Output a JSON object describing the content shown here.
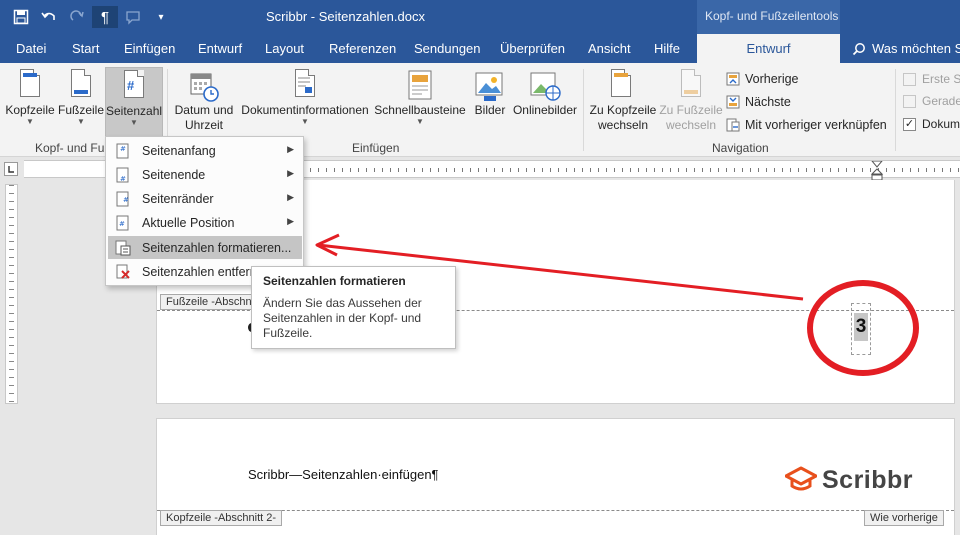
{
  "titlebar": {
    "document_title": "Scribbr - Seitenzahlen.docx",
    "contextual_title": "Kopf- und Fußzeilentools",
    "qat": {
      "save_icon": "save-icon",
      "undo_icon": "undo-icon",
      "redo_icon": "redo-icon",
      "pilcrow_label": "¶",
      "customize_icon": "chevron-down-icon"
    }
  },
  "tabs": [
    {
      "label": "Datei"
    },
    {
      "label": "Start"
    },
    {
      "label": "Einfügen"
    },
    {
      "label": "Entwurf"
    },
    {
      "label": "Layout"
    },
    {
      "label": "Referenzen"
    },
    {
      "label": "Sendungen"
    },
    {
      "label": "Überprüfen"
    },
    {
      "label": "Ansicht"
    },
    {
      "label": "Hilfe"
    },
    {
      "label": "Entwurf",
      "active": true
    }
  ],
  "tell_me": {
    "icon": "search-icon",
    "label": "Was möchten Si"
  },
  "ribbon": {
    "kopfzeile": "Kopfzeile",
    "fusszeile": "Fußzeile",
    "seitenzahl": "Seitenzahl",
    "datum_line1": "Datum und",
    "datum_line2": "Uhrzeit",
    "dokumentinformationen": "Dokumentinformationen",
    "schnellbausteine": "Schnellbausteine",
    "bilder": "Bilder",
    "onlinebilder": "Onlinebilder",
    "zu_kopfzeile_line1": "Zu Kopfzeile",
    "zu_kopfzeile_line2": "wechseln",
    "zu_fusszeile_line1": "Zu Fußzeile",
    "zu_fusszeile_line2": "wechseln",
    "vorherige": "Vorherige",
    "naechste": "Nächste",
    "verknuepfen": "Mit vorheriger verknüpfen",
    "erste_seite": "Erste Se",
    "gerade": "Gerade",
    "dokument": "Dokum",
    "group_kopf_fuss": "Kopf- und Fu",
    "group_einfuegen": "Einfügen",
    "group_navigation": "Navigation"
  },
  "menu": {
    "items": [
      {
        "label": "Seitenanfang",
        "icon": "page-top-icon",
        "submenu": true
      },
      {
        "label": "Seitenende",
        "icon": "page-bottom-icon",
        "submenu": true
      },
      {
        "label": "Seitenränder",
        "icon": "page-margin-icon",
        "submenu": true
      },
      {
        "label": "Aktuelle Position",
        "icon": "page-position-icon",
        "submenu": true
      },
      {
        "label": "Seitenzahlen formatieren...",
        "icon": "format-page-numbers-icon",
        "submenu": false,
        "hover": true
      },
      {
        "label": "Seitenzahlen entferne",
        "icon": "remove-page-numbers-icon",
        "submenu": false
      }
    ],
    "submenu_arrow": "▶"
  },
  "tooltip": {
    "title": "Seitenzahlen formatieren",
    "body": "Ändern Sie das Aussehen der Seitenzahlen in der Kopf- und Fußzeile."
  },
  "document": {
    "footer_tag": "Fußzeile -Abschnitt",
    "page_number": "3",
    "header_tag": "Kopfzeile -Abschnitt 2-",
    "same_as_previous": "Wie vorherige",
    "body_text": "Scribbr—Seitenzahlen·einfügen¶",
    "logo_text": "Scribbr",
    "vruler_labels": "3 · 2 · 1 · · 1 · 2"
  },
  "colors": {
    "word_blue": "#2b579a",
    "contextual_blue": "#3a67a8",
    "annotation_red": "#e31e24",
    "logo_orange": "#e8501c"
  }
}
